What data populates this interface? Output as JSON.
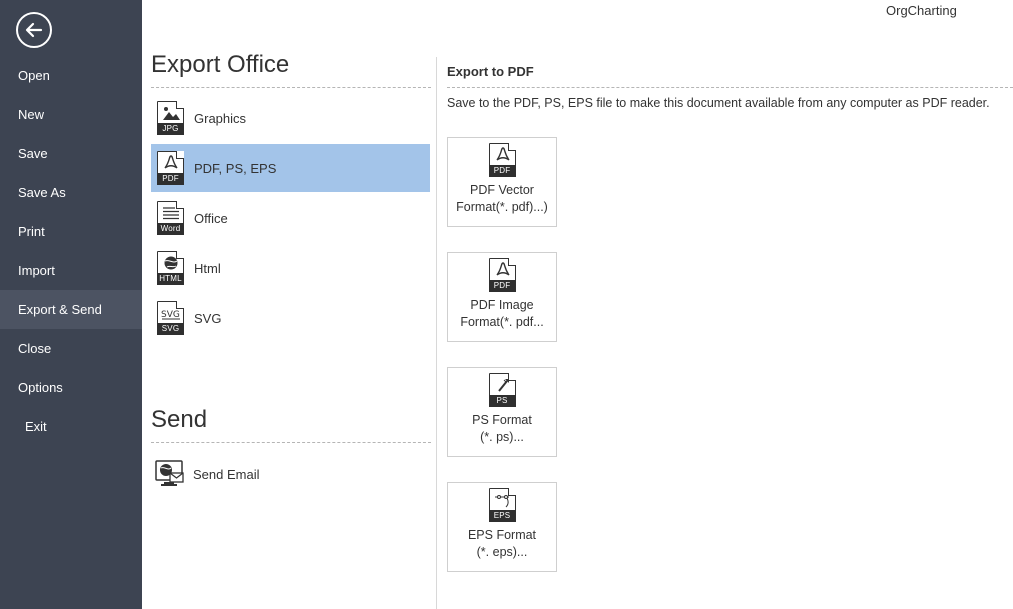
{
  "app": {
    "title": "OrgCharting"
  },
  "sidebar": {
    "back_icon": "arrow-left-circle-icon",
    "items": [
      {
        "label": "Open"
      },
      {
        "label": "New"
      },
      {
        "label": "Save"
      },
      {
        "label": "Save As"
      },
      {
        "label": "Print"
      },
      {
        "label": "Import"
      },
      {
        "label": "Export & Send",
        "active": true
      },
      {
        "label": "Close"
      },
      {
        "label": "Options"
      },
      {
        "label": "Exit"
      }
    ]
  },
  "export_office": {
    "title": "Export Office",
    "items": [
      {
        "label": "Graphics",
        "tag": "JPG",
        "icon": "image-file-icon"
      },
      {
        "label": "PDF, PS, EPS",
        "tag": "PDF",
        "icon": "pdf-file-icon",
        "selected": true
      },
      {
        "label": "Office",
        "tag": "Word",
        "icon": "word-file-icon"
      },
      {
        "label": "Html",
        "tag": "HTML",
        "icon": "html-file-icon"
      },
      {
        "label": "SVG",
        "tag": "SVG",
        "icon": "svg-file-icon"
      }
    ]
  },
  "send": {
    "title": "Send",
    "items": [
      {
        "label": "Send Email",
        "icon": "send-email-icon"
      }
    ]
  },
  "panel": {
    "title": "Export to PDF",
    "description": "Save to the PDF, PS, EPS file to make this document available from any computer as PDF reader.",
    "formats": [
      {
        "line1": "PDF Vector",
        "line2": "Format(*. pdf)...)",
        "tag": "PDF",
        "icon": "pdf-file-icon"
      },
      {
        "line1": "PDF Image",
        "line2": "Format(*. pdf...",
        "tag": "PDF",
        "icon": "pdf-file-icon"
      },
      {
        "line1": "PS Format",
        "line2": "(*. ps)...",
        "tag": "PS",
        "icon": "ps-file-icon"
      },
      {
        "line1": "EPS Format",
        "line2": "(*. eps)...",
        "tag": "EPS",
        "icon": "eps-file-icon"
      }
    ]
  },
  "colors": {
    "sidebar_bg": "#3d4452",
    "sidebar_active": "#4c5362",
    "selected_bg": "#a3c4e9"
  }
}
